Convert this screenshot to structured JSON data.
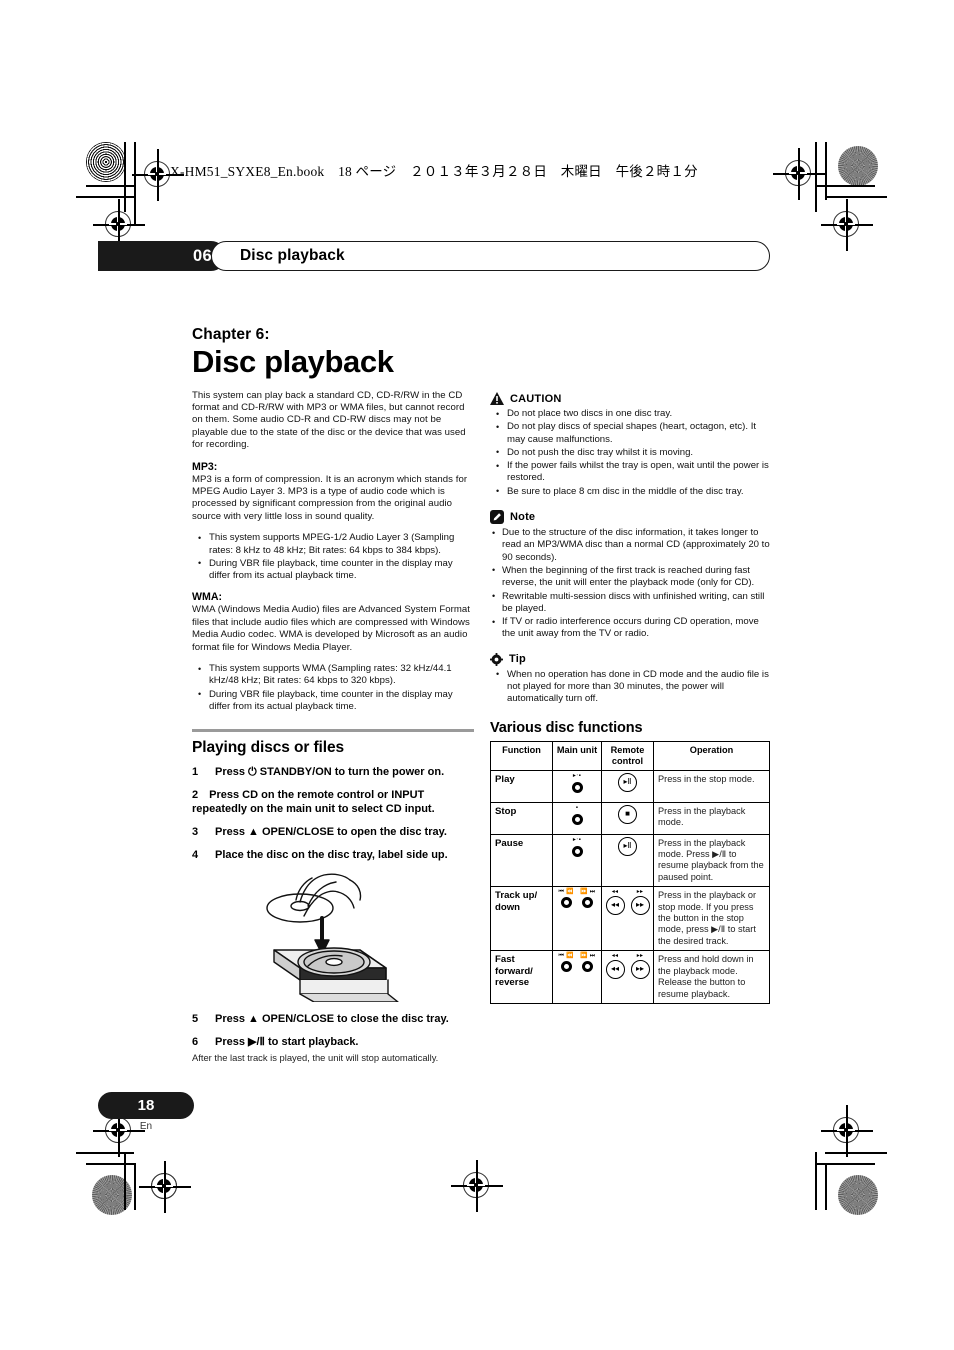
{
  "print_slug": "X-HM51_SYXE8_En.book　18 ページ　２０１３年３月２８日　木曜日　午後２時１分",
  "running_head": {
    "chapter_number": "06",
    "title": "Disc playback"
  },
  "chapter": {
    "label": "Chapter 6:",
    "title": "Disc playback",
    "intro": "This system can play back a standard CD, CD-R/RW in the CD format and CD-R/RW with MP3 or WMA files, but cannot record on them. Some audio CD-R and CD-RW discs may not be playable due to the state of the disc or the device that was used for recording."
  },
  "mp3": {
    "heading": "MP3:",
    "body": "MP3 is a form of compression. It is an acronym which stands for MPEG Audio Layer 3. MP3 is a type of audio code which is processed by significant compression from the original audio source with very little loss in sound quality.",
    "bullets": [
      "This system supports MPEG-1/2 Audio Layer 3 (Sampling rates: 8 kHz to 48 kHz; Bit rates: 64 kbps to 384 kbps).",
      "During VBR file playback, time counter in the display may differ from its actual playback time."
    ]
  },
  "wma": {
    "heading": "WMA:",
    "body": "WMA (Windows Media Audio) files are Advanced System Format files that include audio files which are compressed with Windows Media Audio codec. WMA is developed by Microsoft as an audio format file for Windows Media Player.",
    "bullets": [
      "This system supports WMA (Sampling rates: 32 kHz/44.1 kHz/48 kHz; Bit rates: 64 kbps to 320 kbps).",
      "During VBR file playback, time counter in the display may differ from its actual playback time."
    ]
  },
  "playing": {
    "heading": "Playing discs or files",
    "steps": [
      {
        "n": "1",
        "text": "Press ⏻ STANDBY/ON to turn the power on."
      },
      {
        "n": "2",
        "text": "Press CD on the remote control or INPUT repeatedly on the main unit to select CD input."
      },
      {
        "n": "3",
        "text": "Press ▲ OPEN/CLOSE to open the disc tray."
      },
      {
        "n": "4",
        "text": "Place the disc on the disc tray, label side up."
      },
      {
        "n": "5",
        "text": "Press ▲ OPEN/CLOSE to close the disc tray."
      },
      {
        "n": "6",
        "text": "Press ▶/Ⅱ to start playback."
      }
    ],
    "after_note": "After the last track is played, the unit will stop automatically.",
    "illustration_caption": "hand placing disc on open disc tray"
  },
  "caution": {
    "icon": "warning-triangle-icon",
    "title": "CAUTION",
    "bullets": [
      "Do not place two discs in one disc tray.",
      "Do not play discs of special shapes (heart, octagon, etc). It may cause malfunctions.",
      "Do not push the disc tray whilst it is moving.",
      "If the power fails whilst the tray is open, wait until the power is restored.",
      "Be sure to place 8 cm disc in the middle of the disc tray."
    ]
  },
  "note": {
    "icon": "note-pencil-icon",
    "title": "Note",
    "bullets": [
      "Due to the structure of the disc information, it takes longer to read an MP3/WMA disc than a normal CD (approximately 20 to 90 seconds).",
      "When the beginning of the first track is reached during fast reverse, the unit will enter the playback mode (only for CD).",
      "Rewritable multi-session discs with unfinished writing, can still be played.",
      "If TV or radio interference occurs during CD operation, move the unit away from the TV or radio."
    ]
  },
  "tip": {
    "icon": "tip-gear-icon",
    "title": "Tip",
    "bullets": [
      "When no operation has done in CD mode and the audio file is not played for more than 30 minutes, the power will automatically turn off."
    ]
  },
  "various": {
    "heading": "Various disc functions",
    "columns": [
      "Function",
      "Main unit",
      "Remote control",
      "Operation"
    ],
    "rows": [
      {
        "function": "Play",
        "main_unit": {
          "labels": [
            "▸‧▪"
          ],
          "controls": [
            "knob"
          ]
        },
        "remote": {
          "buttons": [
            "▸Ⅱ"
          ]
        },
        "operation": "Press in the stop mode."
      },
      {
        "function": "Stop",
        "main_unit": {
          "labels": [
            "▪"
          ],
          "controls": [
            "knob"
          ]
        },
        "remote": {
          "buttons": [
            "■"
          ]
        },
        "operation": "Press in the playback mode."
      },
      {
        "function": "Pause",
        "main_unit": {
          "labels": [
            "▸‧▪"
          ],
          "controls": [
            "knob"
          ]
        },
        "remote": {
          "buttons": [
            "▸Ⅱ"
          ]
        },
        "operation": "Press in the playback mode. Press ▶/Ⅱ to resume playback from the paused point."
      },
      {
        "function": "Track up/ down",
        "main_unit": {
          "labels": [
            "⏮ ⏪",
            "⏩ ⏭"
          ],
          "controls": [
            "knob",
            "knob"
          ]
        },
        "remote": {
          "buttons": [
            "◂◂",
            "▸▸"
          ],
          "captions": [
            "◂◂",
            "▸▸"
          ]
        },
        "operation": "Press in the playback or stop mode. If you press the button in the stop mode, press ▶/Ⅱ to start the desired track."
      },
      {
        "function": "Fast forward/ reverse",
        "main_unit": {
          "labels": [
            "⏮ ⏪",
            "⏩ ⏭"
          ],
          "controls": [
            "knob",
            "knob"
          ]
        },
        "remote": {
          "buttons": [
            "◂◂",
            "▸▸"
          ],
          "captions": [
            "◂◂",
            "▸▸"
          ]
        },
        "operation": "Press and hold down in the playback mode.\nRelease the button to resume playback."
      }
    ]
  },
  "folio": {
    "page": "18",
    "language": "En"
  }
}
